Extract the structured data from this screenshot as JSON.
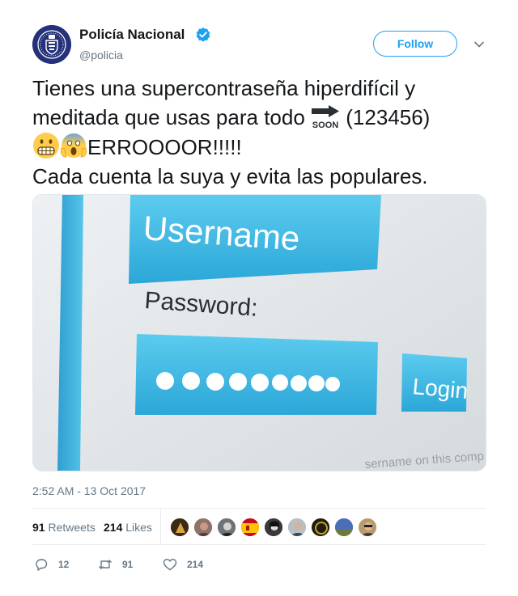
{
  "author": {
    "name": "Policía Nacional",
    "handle": "@policia",
    "avatar_icon": "police-badge-icon",
    "verified_icon": "verified-badge-icon",
    "verified_color": "#1da1f2"
  },
  "follow_label": "Follow",
  "tweet": {
    "line1": "Tienes una supercontraseña hiperdifícil y",
    "line2_start": "meditada que usas para todo ",
    "line2_emoji": "soon-arrow-icon",
    "line2_end": " (123456)",
    "line3_emojis": [
      "grimacing-face-icon",
      "screaming-in-fear-icon"
    ],
    "line3_text": "ERROOOOR!!!!!",
    "line4": "Cada cuenta la suya y evita las populares."
  },
  "media": {
    "username_label": "Username",
    "password_label": "Password:",
    "password_mask_dots": 9,
    "login_label": "Login",
    "bottom_text": "sername on this comp"
  },
  "timestamp": "2:52 AM - 13 Oct 2017",
  "stats": {
    "retweets_count": "91",
    "retweets_label": "Retweets",
    "likes_count": "214",
    "likes_label": "Likes"
  },
  "actions": {
    "replies": "12",
    "retweets": "91",
    "likes": "214"
  },
  "colors": {
    "accent": "#1da1f2",
    "text": "#14171a",
    "muted": "#657786",
    "border": "#e6ecf0",
    "avatar_bg": "#25317a",
    "login_blue": "#38b8e3"
  }
}
